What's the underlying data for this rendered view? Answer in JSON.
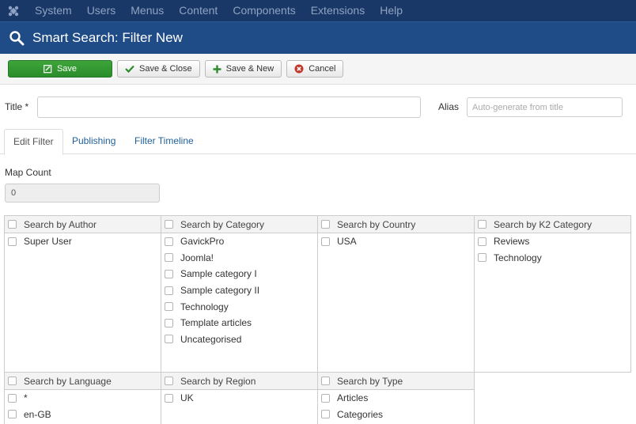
{
  "topnav": {
    "items": [
      "System",
      "Users",
      "Menus",
      "Content",
      "Components",
      "Extensions",
      "Help"
    ]
  },
  "header": {
    "title": "Smart Search: Filter New"
  },
  "toolbar": {
    "save": "Save",
    "save_close": "Save & Close",
    "save_new": "Save & New",
    "cancel": "Cancel"
  },
  "form": {
    "title_label": "Title *",
    "title_value": "",
    "alias_label": "Alias",
    "alias_placeholder": "Auto-generate from title"
  },
  "tabs": [
    "Edit Filter",
    "Publishing",
    "Filter Timeline"
  ],
  "map_count": {
    "label": "Map Count",
    "value": "0"
  },
  "filters": [
    {
      "title": "Search by Author",
      "items": [
        "Super User"
      ]
    },
    {
      "title": "Search by Category",
      "items": [
        "GavickPro",
        "Joomla!",
        "Sample category I",
        "Sample category II",
        "Technology",
        "Template articles",
        "Uncategorised"
      ]
    },
    {
      "title": "Search by Country",
      "items": [
        "USA"
      ]
    },
    {
      "title": "Search by K2 Category",
      "items": [
        "Reviews",
        "Technology"
      ]
    },
    {
      "title": "Search by Language",
      "items": [
        "*",
        "en-GB"
      ]
    },
    {
      "title": "Search by Region",
      "items": [
        "UK"
      ]
    },
    {
      "title": "Search by Type",
      "items": [
        "Articles",
        "Categories"
      ]
    }
  ],
  "colors": {
    "topnav_bg": "#1a3867",
    "header_bg": "#1f4b87",
    "save_green": "#2c8c2b",
    "cancel_red": "#c0392b",
    "link_blue": "#1f5f99"
  }
}
